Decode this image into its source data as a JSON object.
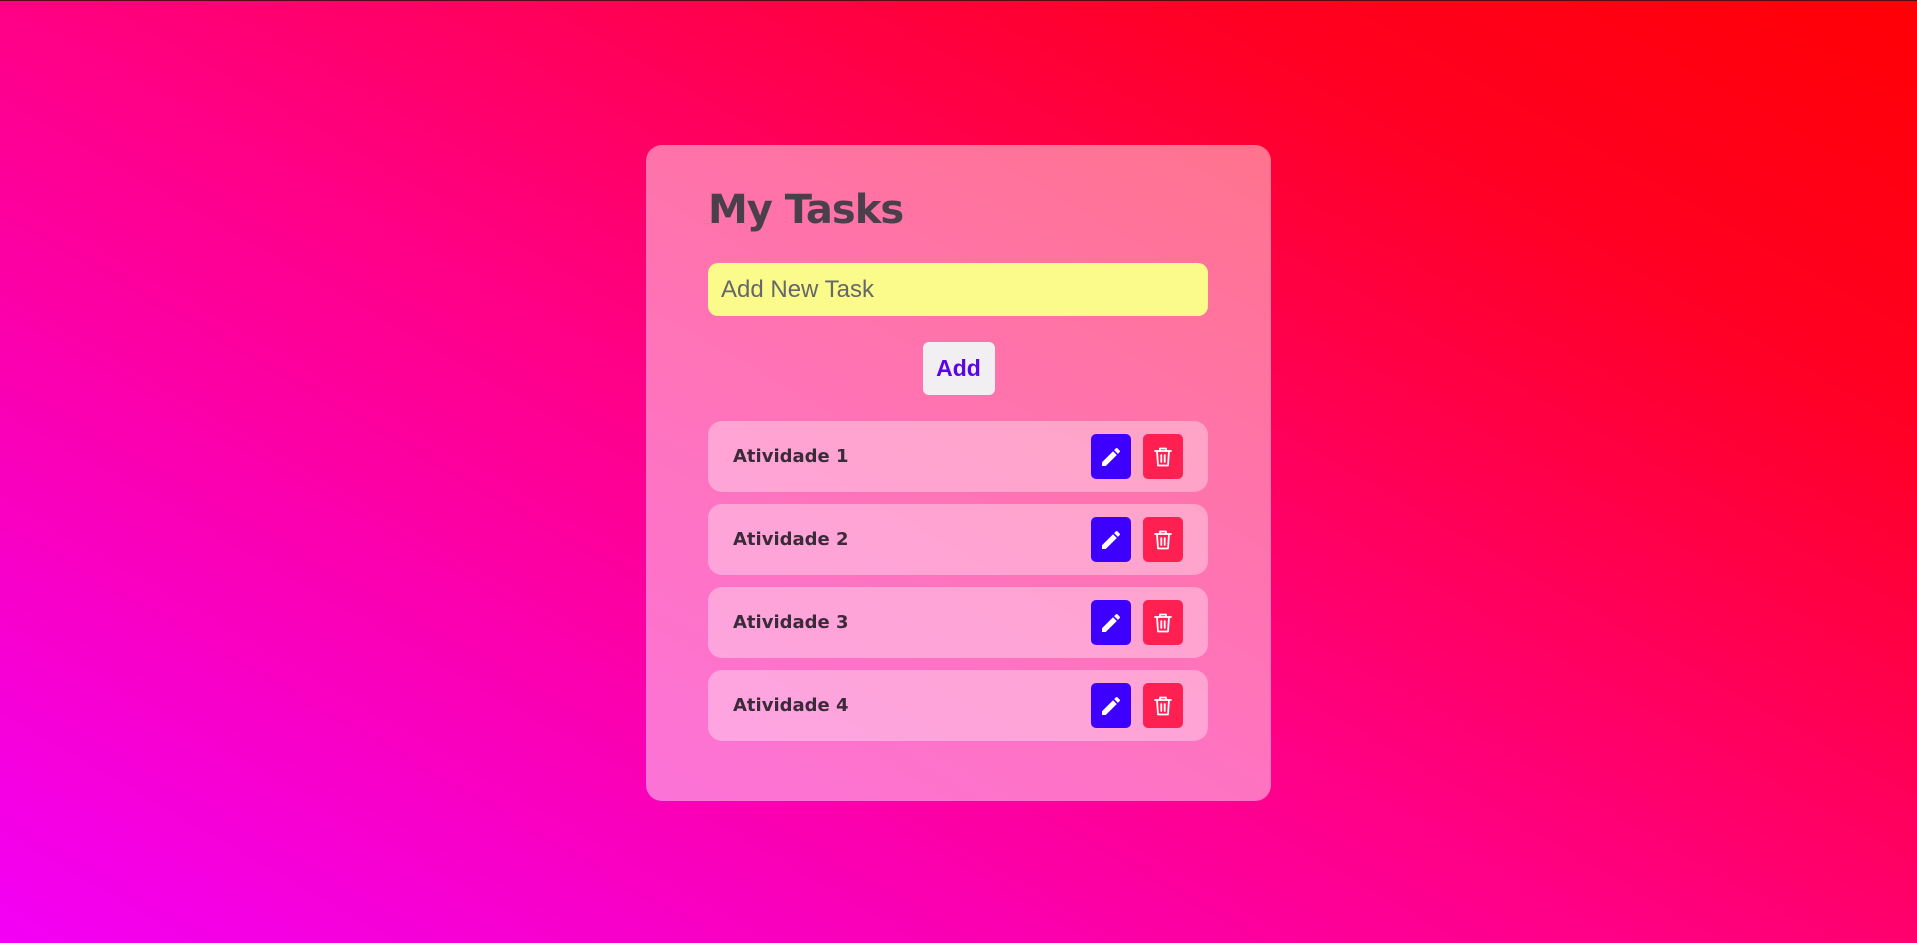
{
  "app": {
    "title": "My Tasks"
  },
  "input": {
    "placeholder": "Add New Task",
    "value": ""
  },
  "add_button": {
    "label": "Add"
  },
  "tasks": [
    {
      "label": "Atividade 1"
    },
    {
      "label": "Atividade 2"
    },
    {
      "label": "Atividade 3"
    },
    {
      "label": "Atividade 4"
    }
  ],
  "icons": {
    "edit": "pencil-icon",
    "delete": "trash-icon"
  },
  "colors": {
    "edit_button": "#3d00ff",
    "delete_button": "#ff2052",
    "input_background": "#fafb8a",
    "add_text": "#5a06e6"
  }
}
